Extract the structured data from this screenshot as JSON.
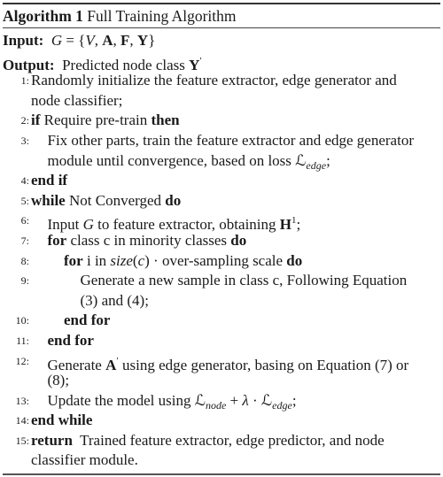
{
  "caption": {
    "label": "Algorithm 1",
    "title": "Full Training Algorithm"
  },
  "header_lines": [
    {
      "parts": [
        {
          "t": "Input:",
          "s": "b"
        },
        {
          "t": "  "
        },
        {
          "t": "G",
          "s": "i"
        },
        {
          "t": " = {"
        },
        {
          "t": "V",
          "s": "i"
        },
        {
          "t": ", "
        },
        {
          "t": "A",
          "s": "b"
        },
        {
          "t": ", "
        },
        {
          "t": "F",
          "s": "b"
        },
        {
          "t": ", "
        },
        {
          "t": "Y",
          "s": "b"
        },
        {
          "t": "}"
        }
      ]
    },
    {
      "parts": [
        {
          "t": "Output:",
          "s": "b"
        },
        {
          "t": "  Predicted node class "
        },
        {
          "t": "Y",
          "s": "b"
        },
        {
          "t": "′",
          "s": "sup"
        }
      ]
    }
  ],
  "lines": [
    {
      "num": "1:",
      "level": 0,
      "parts": [
        {
          "t": "Randomly initialize the feature extractor, edge generator and"
        }
      ]
    },
    {
      "num": "",
      "level": 0,
      "parts": [
        {
          "t": "node classifier;"
        }
      ]
    },
    {
      "num": "2:",
      "level": 0,
      "parts": [
        {
          "t": "if",
          "s": "b"
        },
        {
          "t": " Require pre-train "
        },
        {
          "t": "then",
          "s": "b"
        }
      ]
    },
    {
      "num": "3:",
      "level": 1,
      "parts": [
        {
          "t": "Fix other parts, train the feature extractor and edge generator"
        }
      ]
    },
    {
      "num": "",
      "level": 1,
      "parts": [
        {
          "t": "module until convergence, based on loss "
        },
        {
          "t": "ℒ"
        },
        {
          "t": "edge",
          "s": "sub"
        },
        {
          "t": ";"
        }
      ]
    },
    {
      "num": "4:",
      "level": 0,
      "parts": [
        {
          "t": "end if",
          "s": "b"
        }
      ]
    },
    {
      "num": "5:",
      "level": 0,
      "parts": [
        {
          "t": "while",
          "s": "b"
        },
        {
          "t": " Not Converged "
        },
        {
          "t": "do",
          "s": "b"
        }
      ]
    },
    {
      "num": "6:",
      "level": 1,
      "parts": [
        {
          "t": "Input "
        },
        {
          "t": "G",
          "s": "i"
        },
        {
          "t": " to feature extractor, obtaining "
        },
        {
          "t": "H",
          "s": "b"
        },
        {
          "t": "1",
          "s": "sup"
        },
        {
          "t": ";"
        }
      ]
    },
    {
      "num": "7:",
      "level": 1,
      "parts": [
        {
          "t": "for",
          "s": "b"
        },
        {
          "t": " class c in minority classes "
        },
        {
          "t": "do",
          "s": "b"
        }
      ]
    },
    {
      "num": "8:",
      "level": 2,
      "parts": [
        {
          "t": "for",
          "s": "b"
        },
        {
          "t": " i in "
        },
        {
          "t": "size",
          "s": "i"
        },
        {
          "t": "("
        },
        {
          "t": "c",
          "s": "i"
        },
        {
          "t": ") · over-sampling scale "
        },
        {
          "t": "do",
          "s": "b"
        }
      ]
    },
    {
      "num": "9:",
      "level": 3,
      "parts": [
        {
          "t": "Generate a new sample in class c, Following Equation"
        }
      ]
    },
    {
      "num": "",
      "level": 3,
      "parts": [
        {
          "t": "(3) and (4);"
        }
      ]
    },
    {
      "num": "10:",
      "level": 2,
      "parts": [
        {
          "t": "end for",
          "s": "b"
        }
      ]
    },
    {
      "num": "11:",
      "level": 1,
      "parts": [
        {
          "t": "end for",
          "s": "b"
        }
      ]
    },
    {
      "num": "12:",
      "level": 1,
      "parts": [
        {
          "t": "Generate "
        },
        {
          "t": "A",
          "s": "b"
        },
        {
          "t": "′",
          "s": "sup"
        },
        {
          "t": " using edge generator, basing on Equation (7) or"
        }
      ]
    },
    {
      "num": "",
      "level": 1,
      "parts": [
        {
          "t": "(8);"
        }
      ]
    },
    {
      "num": "13:",
      "level": 1,
      "parts": [
        {
          "t": "Update the model using "
        },
        {
          "t": "ℒ"
        },
        {
          "t": "node",
          "s": "sub"
        },
        {
          "t": " + "
        },
        {
          "t": "λ",
          "s": "i"
        },
        {
          "t": " · "
        },
        {
          "t": "ℒ"
        },
        {
          "t": "edge",
          "s": "sub"
        },
        {
          "t": ";"
        }
      ]
    },
    {
      "num": "14:",
      "level": 0,
      "parts": [
        {
          "t": "end while",
          "s": "b"
        }
      ]
    },
    {
      "num": "15:",
      "level": 0,
      "parts": [
        {
          "t": "return",
          "s": "b"
        },
        {
          "t": "  Trained feature extractor, edge predictor, and node"
        }
      ]
    },
    {
      "num": "",
      "level": 0,
      "parts": [
        {
          "t": "classifier module."
        }
      ]
    }
  ]
}
